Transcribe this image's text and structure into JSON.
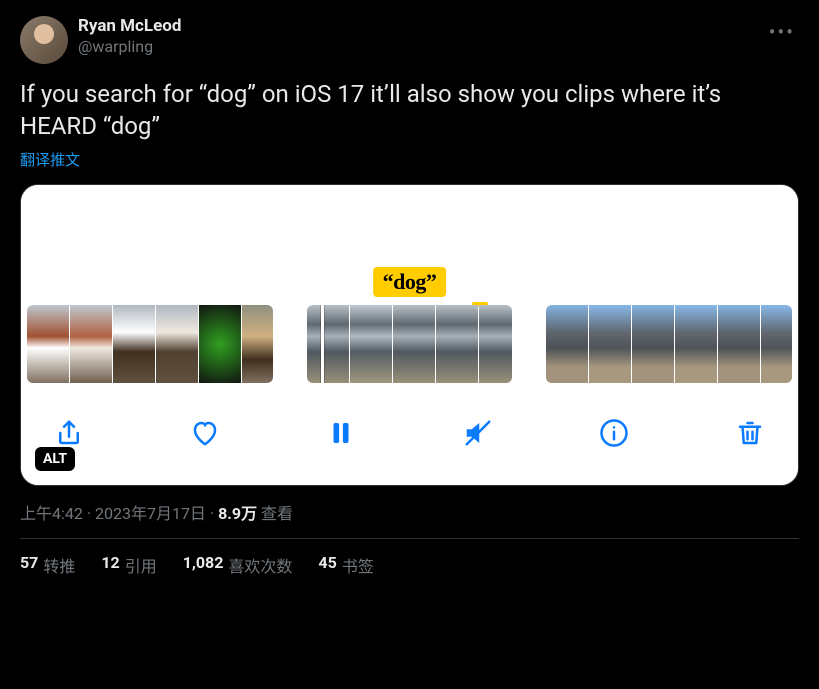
{
  "author": {
    "display_name": "Ryan McLeod",
    "handle": "@warpling"
  },
  "tweet_text": "If you search for “dog” on iOS 17 it’ll also show you clips where it’s HEARD “dog”",
  "translate_label": "翻译推文",
  "media": {
    "tooltip": "“dog”",
    "alt_label": "ALT",
    "controls": {
      "share": "share-icon",
      "like": "heart-icon",
      "pause": "pause-icon",
      "mute": "mute-icon",
      "info": "info-icon",
      "trash": "trash-icon"
    }
  },
  "meta": {
    "time": "上午4:42",
    "dot": " · ",
    "date": "2023年7月17日",
    "views_num": "8.9万",
    "views_label": " 查看"
  },
  "counts": {
    "retweets": {
      "num": "57",
      "label": "转推"
    },
    "quotes": {
      "num": "12",
      "label": "引用"
    },
    "likes": {
      "num": "1,082",
      "label": "喜欢次数"
    },
    "bookmarks": {
      "num": "45",
      "label": "书签"
    }
  }
}
